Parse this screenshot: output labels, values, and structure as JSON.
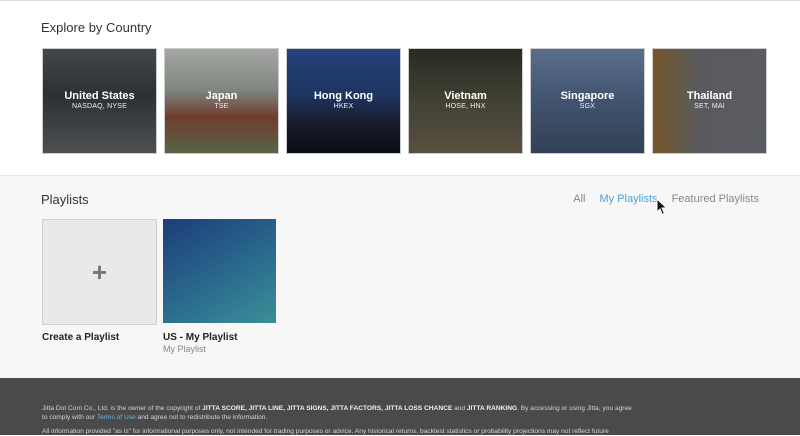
{
  "explore": {
    "title": "Explore by Country",
    "countries": [
      {
        "name": "United States",
        "exchanges": "NASDAQ, NYSE"
      },
      {
        "name": "Japan",
        "exchanges": "TSE"
      },
      {
        "name": "Hong Kong",
        "exchanges": "HKEX"
      },
      {
        "name": "Vietnam",
        "exchanges": "HOSE, HNX"
      },
      {
        "name": "Singapore",
        "exchanges": "SGX"
      },
      {
        "name": "Thailand",
        "exchanges": "SET, MAI"
      }
    ]
  },
  "playlists": {
    "title": "Playlists",
    "filters": [
      "All",
      "My Playlists",
      "Featured Playlists"
    ],
    "active_filter": "My Playlists",
    "create": {
      "label": "Create a Playlist",
      "icon": "plus-icon"
    },
    "items": [
      {
        "title": "US - My Playlist",
        "subtitle": "My Playlist"
      }
    ]
  },
  "footer": {
    "line1_a": "Jitta Dot Com Co., Ltd. is the owner of the copyright of ",
    "line1_b": "JITTA SCORE, JITTA LINE, JITTA SIGNS, JITTA FACTORS, JITTA LOSS CHANCE",
    "line1_c": " and ",
    "line1_d": "JITTA RANKING",
    "line1_e": ". By accessing or using Jitta, you agree to comply with our ",
    "terms_link": "Terms of Use",
    "line1_f": " and agree not to redistribute the information.",
    "line2": "All information provided \"as is\" for informational purposes only, not intended for trading purposes or advice. Any historical returns, backtest statistics or probability projections may not reflect future"
  },
  "colors": {
    "accent": "#4aa3d6",
    "footer_bg": "#4a4a4a"
  }
}
